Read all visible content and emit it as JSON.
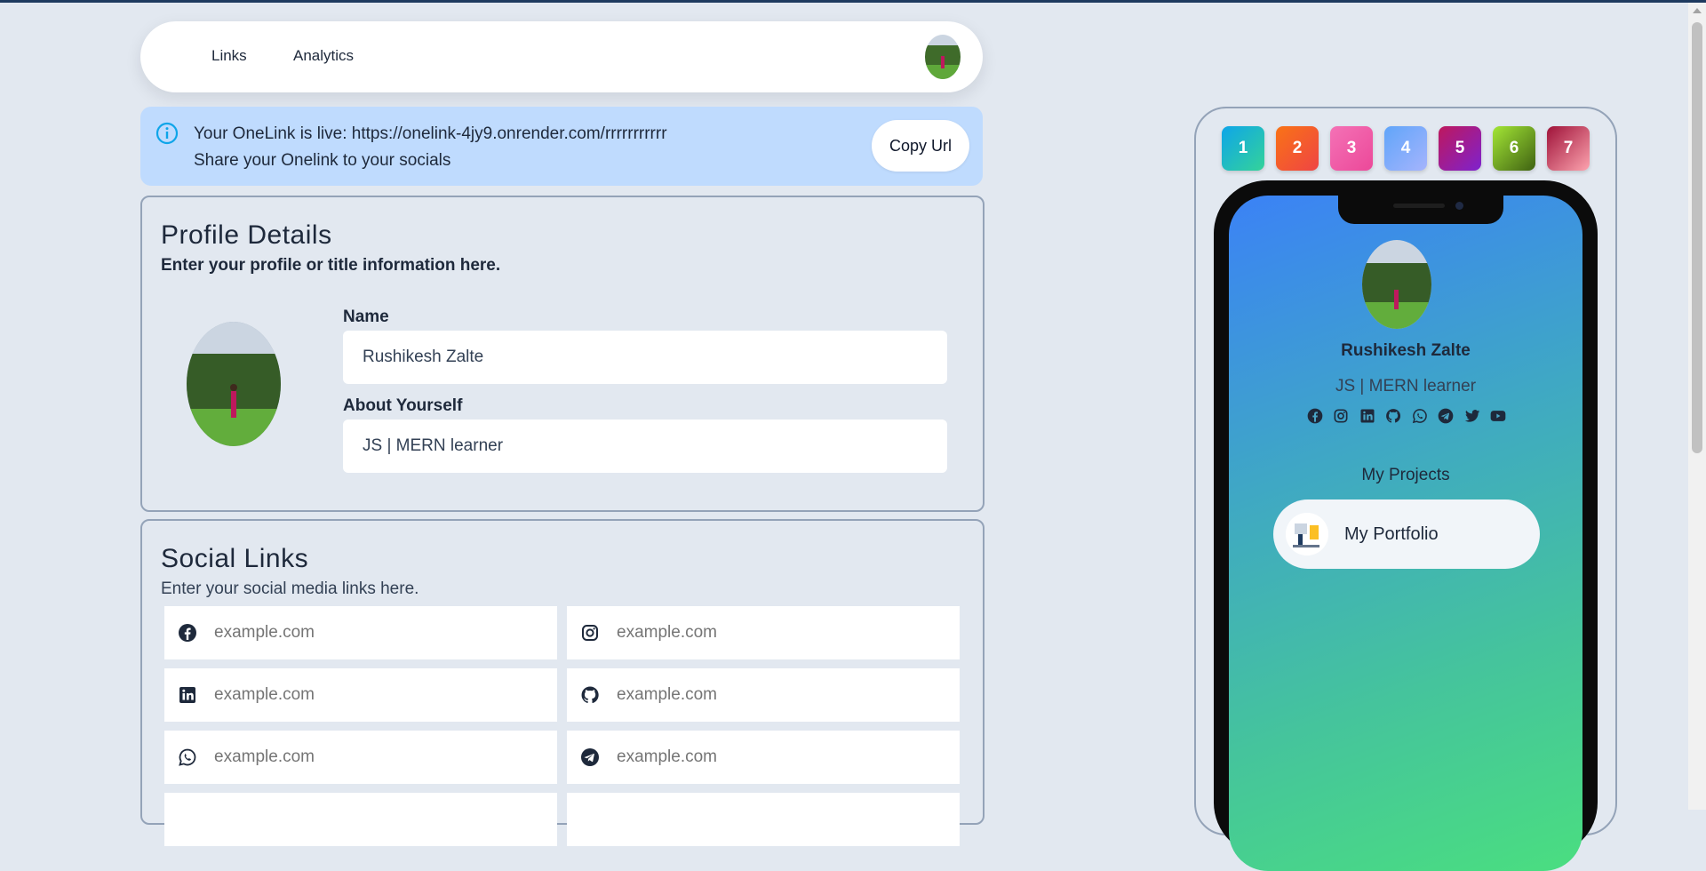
{
  "nav": {
    "tabs": [
      {
        "label": "Links"
      },
      {
        "label": "Analytics"
      }
    ],
    "avatar_icon": "user-avatar-photo"
  },
  "alert": {
    "line1": "Your OneLink is live: https://onelink-4jy9.onrender.com/rrrrrrrrrrr",
    "line2": "Share your Onelink to your socials",
    "copy_label": "Copy Url",
    "icon": "info-icon"
  },
  "profile": {
    "title": "Profile Details",
    "subtitle": "Enter your profile or title information here.",
    "name_label": "Name",
    "name_value": "Rushikesh Zalte",
    "about_label": "About Yourself",
    "about_value": "JS | MERN learner"
  },
  "social": {
    "title": "Social Links",
    "subtitle": "Enter your social media links here.",
    "fields": [
      {
        "icon": "facebook-icon",
        "placeholder": "example.com"
      },
      {
        "icon": "instagram-icon",
        "placeholder": "example.com"
      },
      {
        "icon": "linkedin-icon",
        "placeholder": "example.com"
      },
      {
        "icon": "github-icon",
        "placeholder": "example.com"
      },
      {
        "icon": "whatsapp-icon",
        "placeholder": "example.com"
      },
      {
        "icon": "telegram-icon",
        "placeholder": "example.com"
      },
      {
        "icon": "twitter-icon",
        "placeholder": ""
      },
      {
        "icon": "youtube-icon",
        "placeholder": ""
      }
    ]
  },
  "themes": [
    {
      "label": "1",
      "color": "#0ea5e9"
    },
    {
      "label": "2",
      "color": "#f97316"
    },
    {
      "label": "3",
      "color": "#f472b6"
    },
    {
      "label": "4",
      "color": "#60a5fa"
    },
    {
      "label": "5",
      "color": "#be185d"
    },
    {
      "label": "6",
      "color": "#84cc16"
    },
    {
      "label": "7",
      "color": "#be123c"
    }
  ],
  "preview": {
    "name": "Rushikesh Zalte",
    "about": "JS | MERN learner",
    "section_title": "My Projects",
    "link_label": "My Portfolio",
    "icons": [
      "facebook-icon",
      "instagram-icon",
      "linkedin-icon",
      "github-icon",
      "whatsapp-icon",
      "telegram-icon",
      "twitter-icon",
      "youtube-icon"
    ],
    "gradient": [
      "#3b82f6",
      "#4ade80"
    ]
  }
}
